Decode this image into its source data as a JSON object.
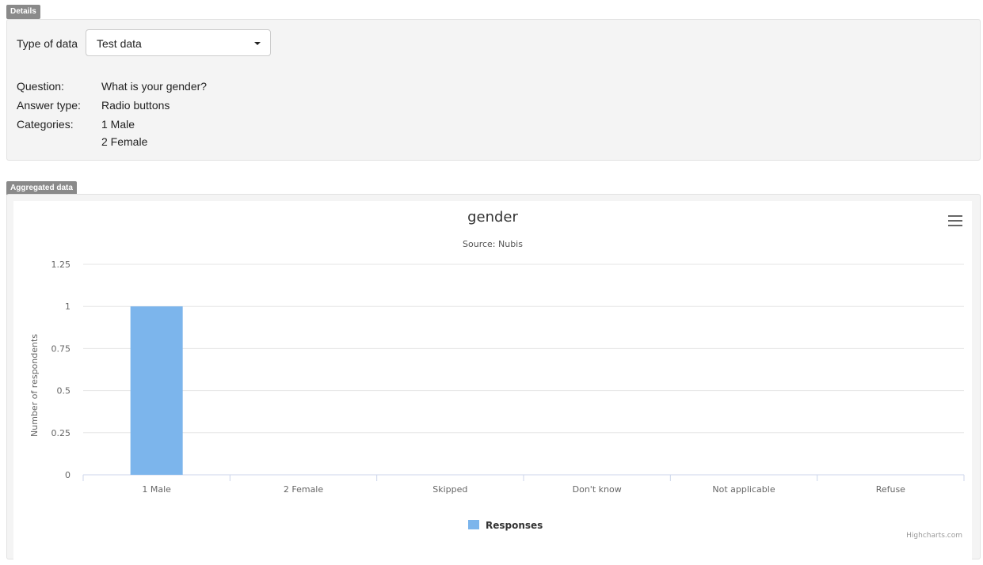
{
  "details": {
    "tag": "Details",
    "type_label": "Type of data",
    "type_value": "Test data",
    "question_label": "Question:",
    "question_value": "What is your gender?",
    "answer_type_label": "Answer type:",
    "answer_type_value": "Radio buttons",
    "categories_label": "Categories:",
    "categories": [
      "1 Male",
      "2 Female"
    ]
  },
  "aggregated": {
    "tag": "Aggregated data",
    "credits": "Highcharts.com"
  },
  "colors": {
    "bar": "#7cb5ec",
    "grid": "#e6e6e6",
    "axis": "#ccd6eb"
  },
  "chart_data": {
    "type": "bar",
    "title": "gender",
    "subtitle": "Source: Nubis",
    "xlabel": "",
    "ylabel": "Number of respondents",
    "categories": [
      "1 Male",
      "2 Female",
      "Skipped",
      "Don't know",
      "Not applicable",
      "Refuse"
    ],
    "series": [
      {
        "name": "Responses",
        "values": [
          1,
          0,
          0,
          0,
          0,
          0
        ]
      }
    ],
    "ylim": [
      0,
      1.25
    ],
    "yticks": [
      "0",
      "0.25",
      "0.5",
      "0.75",
      "1",
      "1.25"
    ],
    "grid": true,
    "legend": "bottom-center"
  }
}
